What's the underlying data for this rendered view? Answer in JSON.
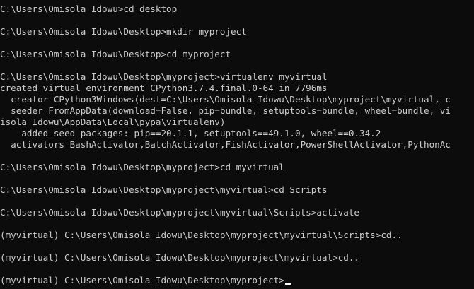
{
  "console": {
    "lines": [
      "C:\\Users\\Omisola Idowu>cd desktop",
      "",
      "C:\\Users\\Omisola Idowu\\Desktop>mkdir myproject",
      "",
      "C:\\Users\\Omisola Idowu\\Desktop>cd myproject",
      "",
      "C:\\Users\\Omisola Idowu\\Desktop\\myproject>virtualenv myvirtual",
      "created virtual environment CPython3.7.4.final.0-64 in 7796ms",
      "  creator CPython3Windows(dest=C:\\Users\\Omisola Idowu\\Desktop\\myproject\\myvirtual, c",
      "  seeder FromAppData(download=False, pip=bundle, setuptools=bundle, wheel=bundle, vi",
      "isola Idowu\\AppData\\Local\\pypa\\virtualenv)",
      "    added seed packages: pip==20.1.1, setuptools==49.1.0, wheel==0.34.2",
      "  activators BashActivator,BatchActivator,FishActivator,PowerShellActivator,PythonAc",
      "",
      "C:\\Users\\Omisola Idowu\\Desktop\\myproject>cd myvirtual",
      "",
      "C:\\Users\\Omisola Idowu\\Desktop\\myproject\\myvirtual>cd Scripts",
      "",
      "C:\\Users\\Omisola Idowu\\Desktop\\myproject\\myvirtual\\Scripts>activate",
      "",
      "(myvirtual) C:\\Users\\Omisola Idowu\\Desktop\\myproject\\myvirtual\\Scripts>cd..",
      "",
      "(myvirtual) C:\\Users\\Omisola Idowu\\Desktop\\myproject\\myvirtual>cd..",
      "",
      "(myvirtual) C:\\Users\\Omisola Idowu\\Desktop\\myproject>"
    ]
  }
}
